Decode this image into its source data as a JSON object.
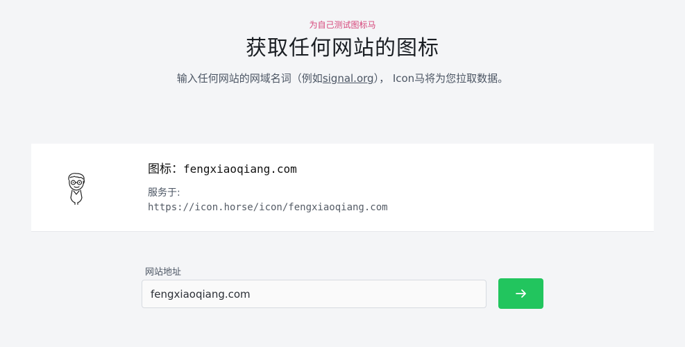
{
  "header": {
    "eyebrow": "为自己测试图标马",
    "title": "获取任何网站的图标",
    "subtitle_before": "输入任何网站的网域名词（例如",
    "subtitle_link": "signal.org",
    "subtitle_after": "）， Icon马将为您拉取数据。"
  },
  "result": {
    "icon_label": "图标：",
    "domain": "fengxiaoqiang.com",
    "served_label": "服务于:",
    "served_url": "https://icon.horse/icon/fengxiaoqiang.com"
  },
  "form": {
    "field_label": "网站地址",
    "input_value": "fengxiaoqiang.com",
    "button_icon": "arrow-right-icon"
  },
  "colors": {
    "accent_pink": "#d6457a",
    "button_green": "#22c55e",
    "background": "#f4f5f7"
  }
}
